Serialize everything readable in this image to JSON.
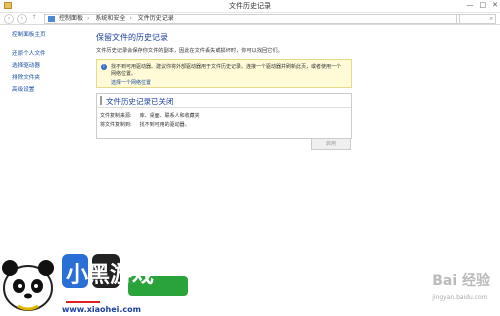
{
  "window": {
    "title": "文件历史记录",
    "ctrl_min": "—",
    "ctrl_max": "□",
    "ctrl_close": "✕"
  },
  "address": {
    "crumbs": [
      "控制面板",
      "系统和安全",
      "文件历史记录"
    ],
    "refresh": "⟳"
  },
  "sidebar": {
    "home": "控制面板主页",
    "items": [
      "还原个人文件",
      "选择驱动器",
      "排除文件夹",
      "高级设置"
    ]
  },
  "main": {
    "heading": "保留文件的历史记录",
    "desc": "文件历史记录会保存你文件的副本，因此在文件丢失或损坏时，你可以找回它们。",
    "warning": {
      "text": "找不到可用驱动器。建议你将外部驱动器用于文件历史记录。连接一个驱动器并刷新此页，或者使用一个网络位置。",
      "link": "选择一个网络位置"
    },
    "status": {
      "title": "文件历史记录已关闭",
      "copy_label": "文件复制来源:",
      "copy_value": "库、桌面、联系人和收藏夹",
      "target_label": "将文件复制到:",
      "target_value": "找不到可用的驱动器。"
    },
    "run_button": "启用"
  },
  "watermark": {
    "brand": "小黑游戏",
    "site": "www.xiaohei.com",
    "baidu": "Bai 经验",
    "baidu_sub": "jingyan.baidu.com"
  }
}
